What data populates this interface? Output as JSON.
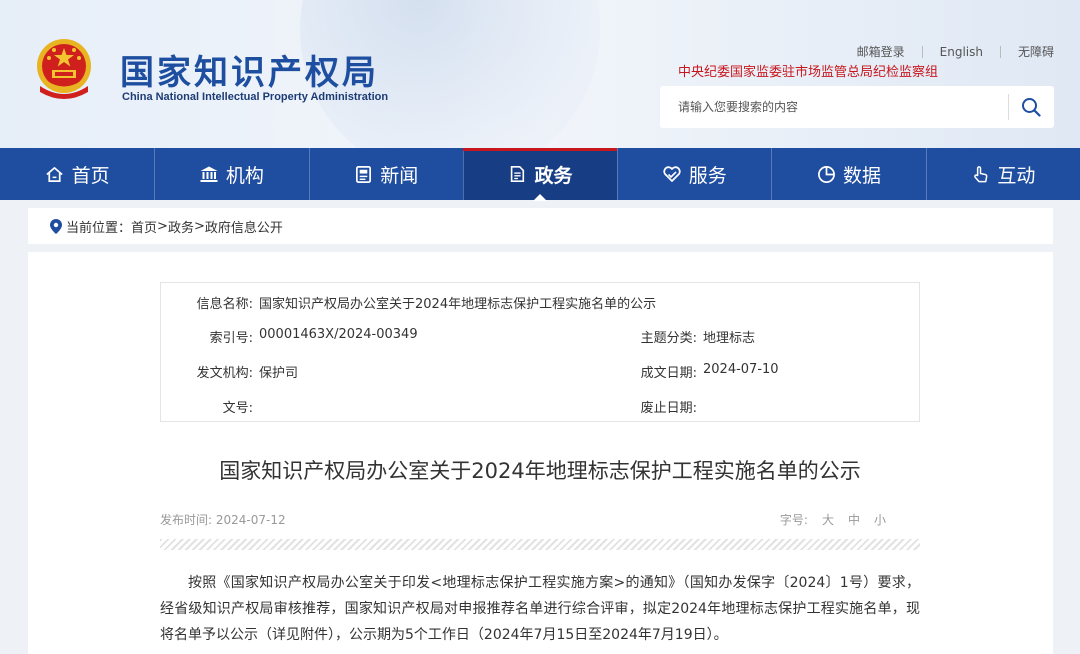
{
  "header": {
    "logo_cn": "国家知识产权局",
    "logo_en": "China National Intellectual Property Administration",
    "links": [
      "邮箱登录",
      "English",
      "无障碍"
    ],
    "inspection": "中央纪委国家监委驻市场监管总局纪检监察组",
    "search_placeholder": "请输入您要搜索的内容"
  },
  "nav": {
    "items": [
      {
        "label": "首页",
        "icon": "home-icon"
      },
      {
        "label": "机构",
        "icon": "institution-icon"
      },
      {
        "label": "新闻",
        "icon": "news-icon"
      },
      {
        "label": "政务",
        "icon": "document-icon",
        "active": true
      },
      {
        "label": "服务",
        "icon": "service-icon"
      },
      {
        "label": "数据",
        "icon": "data-icon"
      },
      {
        "label": "互动",
        "icon": "interaction-icon"
      }
    ]
  },
  "breadcrumb": {
    "prefix": "当前位置：",
    "items": [
      "首页",
      "政务",
      "政府信息公开"
    ],
    "sep": ">"
  },
  "info": {
    "name_label": "信息名称:",
    "name_value": "国家知识产权局办公室关于2024年地理标志保护工程实施名单的公示",
    "index_label": "索引号:",
    "index_value": "00001463X/2024-00349",
    "topic_label": "主题分类:",
    "topic_value": "地理标志",
    "issuer_label": "发文机构:",
    "issuer_value": "保护司",
    "created_label": "成文日期:",
    "created_value": "2024-07-10",
    "docno_label": "文号:",
    "docno_value": "",
    "abolish_label": "废止日期:",
    "abolish_value": ""
  },
  "article": {
    "title": "国家知识产权局办公室关于2024年地理标志保护工程实施名单的公示",
    "pub_label": "发布时间:",
    "pub_date": "2024-07-12",
    "fontsize_label": "字号:",
    "fontsize_options": [
      "大",
      "中",
      "小"
    ],
    "paragraph": "按照《国家知识产权局办公室关于印发<地理标志保护工程实施方案>的通知》（国知办发保字〔2024〕1号）要求，经省级知识产权局审核推荐，国家知识产权局对申报推荐名单进行综合评审，拟定2024年地理标志保护工程实施名单，现将名单予以公示（详见附件），公示期为5个工作日（2024年7月15日至2024年7月19日）。"
  },
  "colors": {
    "brand_blue": "#1f4ea1",
    "active_nav": "#173d84",
    "accent_red": "#c8161d"
  }
}
